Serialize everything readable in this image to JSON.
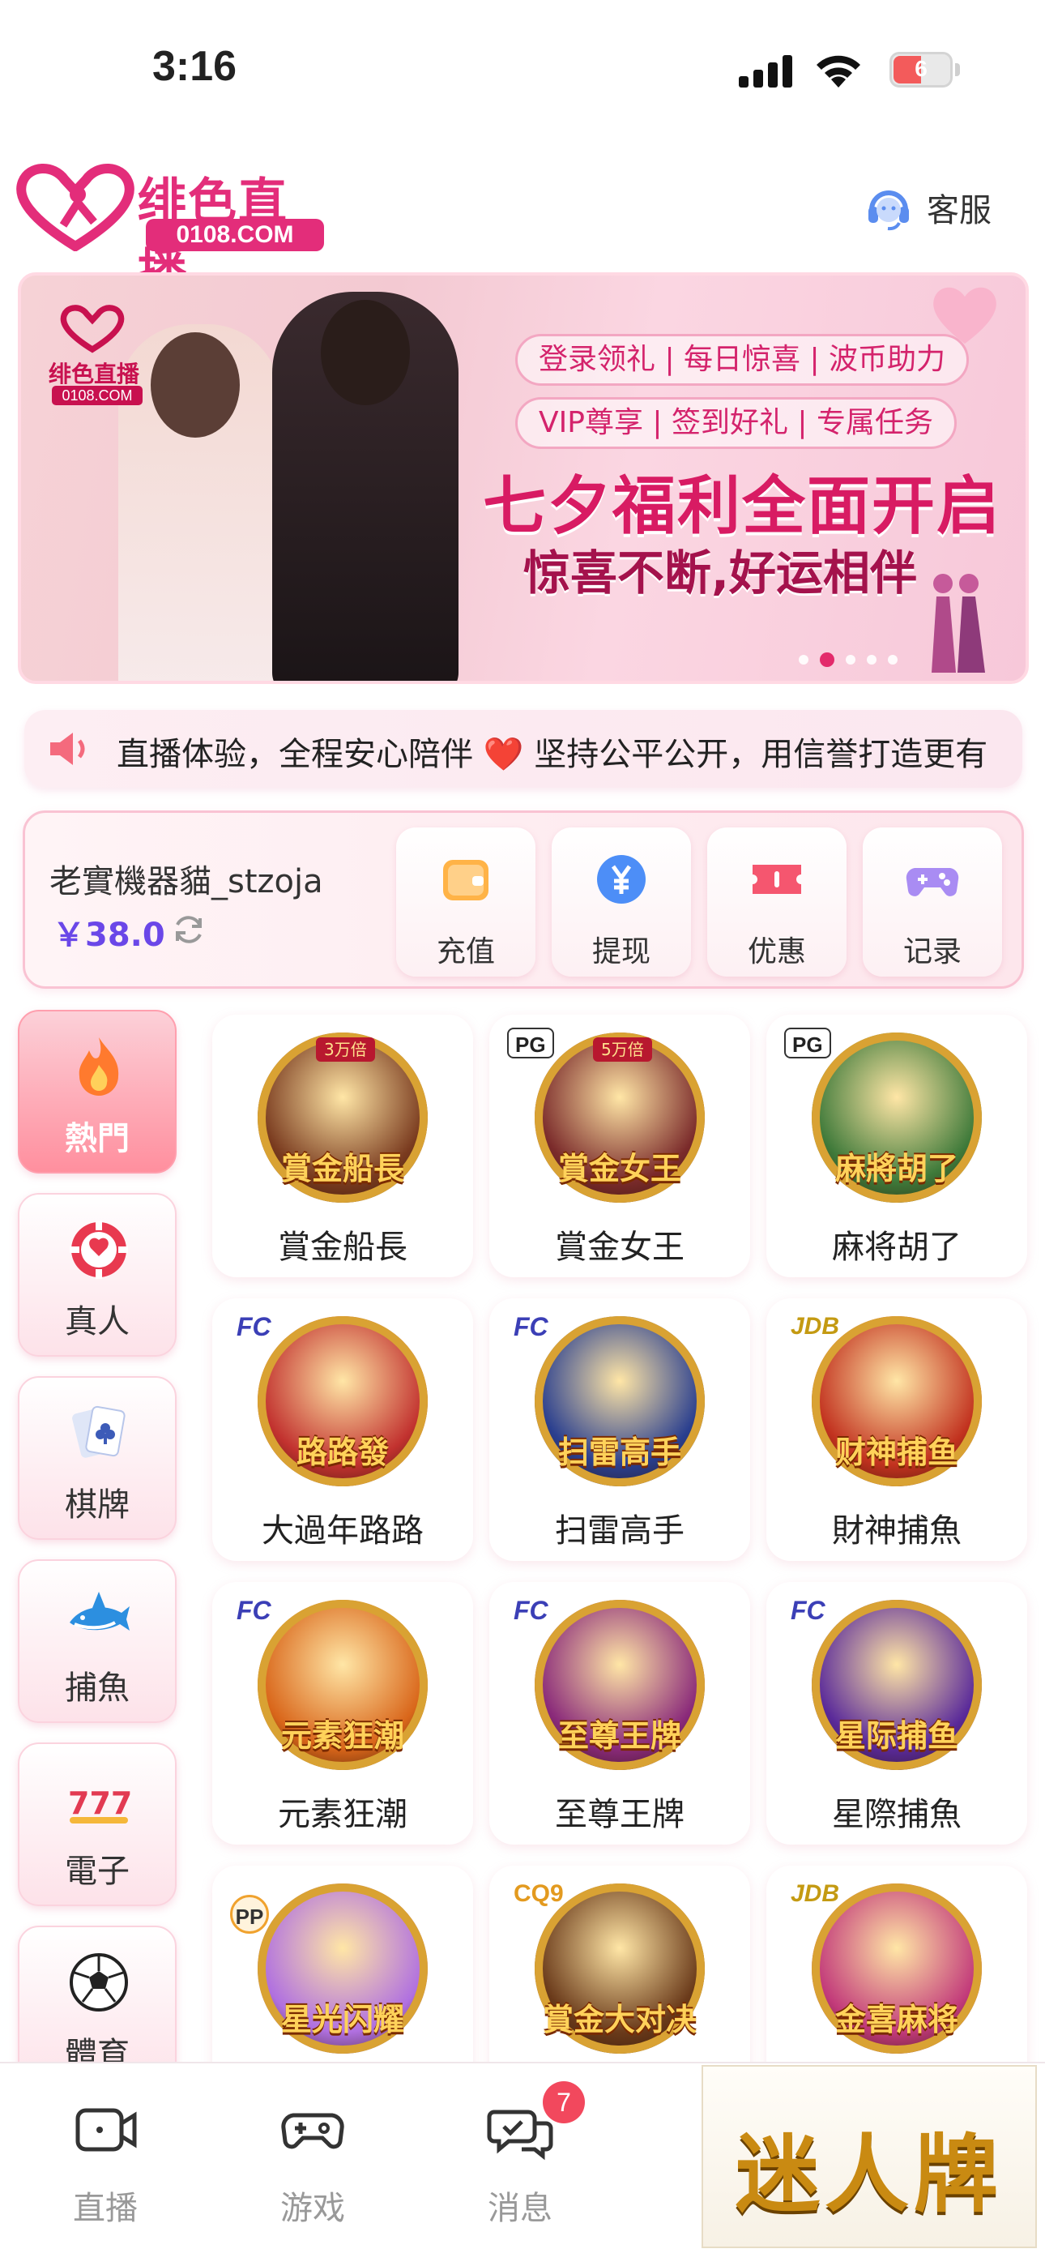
{
  "status_bar": {
    "time": "3:16",
    "battery": "6"
  },
  "header": {
    "logo_text": "绯色直播",
    "logo_domain": "0108.COM",
    "service_label": "客服"
  },
  "banner": {
    "mini_logo_text": "绯色直播",
    "mini_logo_domain": "0108.COM",
    "tags_line1": "登录领礼 | 每日惊喜 | 波币助力",
    "tags_line2": "VIP尊享 | 签到好礼 | 专属任务",
    "headline": "七夕福利全面开启",
    "subline": "惊喜不断,好运相伴",
    "active_slide": 2,
    "slide_count": 5
  },
  "marquee": {
    "text": " 直播体验，全程安心陪伴 ❤️ 坚持公平公开，用信誉打造更有"
  },
  "user": {
    "name": "老實機器貓_stzoja",
    "balance": "￥38.0"
  },
  "quick_actions": [
    {
      "label": "充值",
      "icon": "wallet-icon"
    },
    {
      "label": "提现",
      "icon": "yen-coin-icon"
    },
    {
      "label": "优惠",
      "icon": "ticket-icon"
    },
    {
      "label": "记录",
      "icon": "gamepad-icon"
    }
  ],
  "categories": [
    {
      "label": "熱門",
      "icon": "flame-icon",
      "active": true
    },
    {
      "label": "真人",
      "icon": "poker-chip-icon"
    },
    {
      "label": "棋牌",
      "icon": "playing-cards-icon"
    },
    {
      "label": "捕魚",
      "icon": "shark-icon"
    },
    {
      "label": "電子",
      "icon": "slot-777-icon"
    },
    {
      "label": "體育",
      "icon": "soccer-ball-icon"
    }
  ],
  "games": [
    {
      "name": "賞金船長",
      "art_title": "賞金船長",
      "badge": "",
      "multiplier": "3万倍",
      "color": "#7a3b1f"
    },
    {
      "name": "賞金女王",
      "art_title": "賞金女王",
      "badge": "PG",
      "multiplier": "5万倍",
      "color": "#7b2b2b"
    },
    {
      "name": "麻将胡了",
      "art_title": "麻將胡了",
      "badge": "PG",
      "multiplier": "",
      "color": "#3f7a3a"
    },
    {
      "name": "大過年路路",
      "art_title": "路路發",
      "badge": "FC",
      "multiplier": "",
      "color": "#c2322f"
    },
    {
      "name": "扫雷高手",
      "art_title": "扫雷高手",
      "badge": "FC",
      "multiplier": "",
      "color": "#2a3f8f"
    },
    {
      "name": "財神捕魚",
      "art_title": "财神捕鱼",
      "badge": "JDB",
      "multiplier": "",
      "color": "#c2321f"
    },
    {
      "name": "元素狂潮",
      "art_title": "元素狂潮",
      "badge": "FC",
      "multiplier": "",
      "color": "#d9661a"
    },
    {
      "name": "至尊王牌",
      "art_title": "至尊王牌",
      "badge": "FC",
      "multiplier": "",
      "color": "#8a2a7a"
    },
    {
      "name": "星際捕魚",
      "art_title": "星际捕鱼",
      "badge": "FC",
      "multiplier": "",
      "color": "#5a2a9a"
    },
    {
      "name": "",
      "art_title": "星光闪耀",
      "badge": "PP",
      "multiplier": "",
      "color": "#b070e0"
    },
    {
      "name": "",
      "art_title": "賞金大对决",
      "badge": "CQ9",
      "multiplier": "",
      "color": "#6a3a1a"
    },
    {
      "name": "",
      "art_title": "金喜麻将",
      "badge": "JDB",
      "multiplier": "",
      "color": "#c23a7a"
    }
  ],
  "bottom_nav": [
    {
      "label": "直播",
      "icon": "video-camera-icon"
    },
    {
      "label": "游戏",
      "icon": "gamepad-icon"
    },
    {
      "label": "消息",
      "icon": "chat-bubbles-icon",
      "badge": "7"
    }
  ],
  "promo": {
    "text": "迷人牌"
  },
  "colors": {
    "accent": "#e0185e",
    "balance": "#6a47e8",
    "active_category": "#ff8f9e"
  }
}
